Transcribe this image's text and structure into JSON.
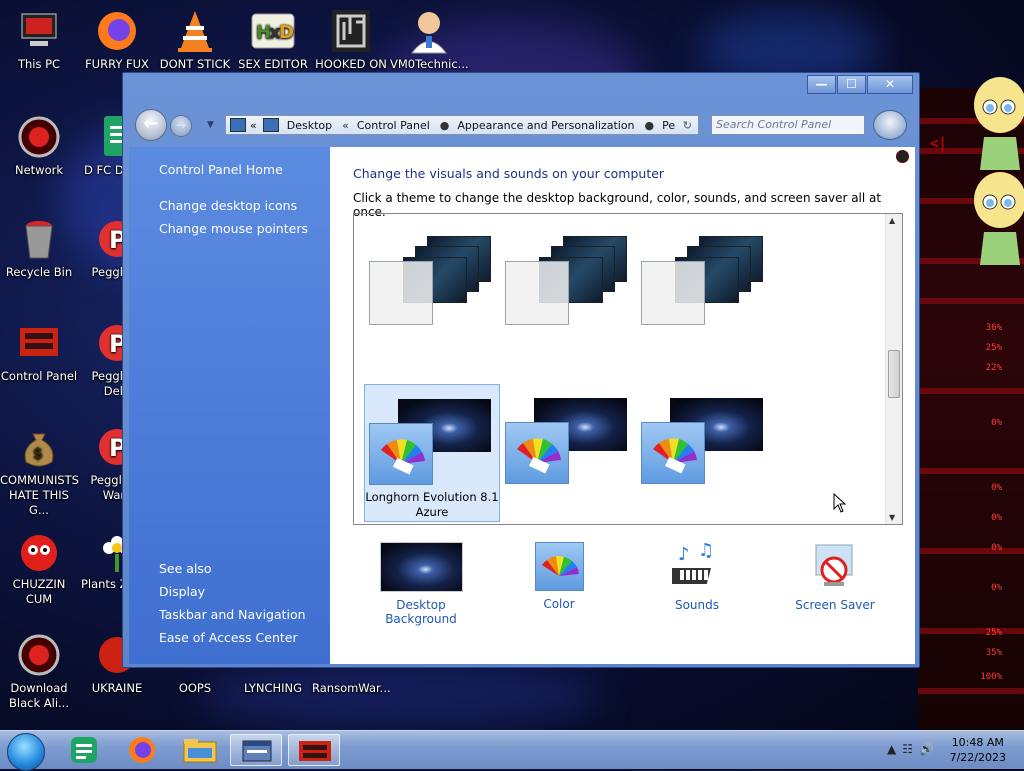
{
  "desktop": {
    "icons": [
      {
        "label": "This PC",
        "icon": "computer-icon"
      },
      {
        "label": "FURRY FUX",
        "icon": "firefox-icon"
      },
      {
        "label": "DONT STICK",
        "icon": "vlc-cone-icon"
      },
      {
        "label": "SEX EDITOR",
        "icon": "hex-editor-icon"
      },
      {
        "label": "HOOKED ON",
        "icon": "maze-icon"
      },
      {
        "label": "VM0Technic...",
        "icon": "doctor-icon"
      },
      {
        "label": "Network",
        "icon": "network-icon"
      },
      {
        "label": "D FC DUMB",
        "icon": "document-icon"
      },
      {
        "label": "Recycle Bin",
        "icon": "recycle-bin-icon"
      },
      {
        "label": "Peggle D",
        "icon": "peggle-icon"
      },
      {
        "label": "Control Panel",
        "icon": "control-panel-icon"
      },
      {
        "label": "Peggle D Delu",
        "icon": "peggle-icon"
      },
      {
        "label": "COMMUNISTS HATE THIS G...",
        "icon": "money-bag-icon"
      },
      {
        "label": "Peggle of Warc",
        "icon": "peggle-icon"
      },
      {
        "label": "CHUZZIN CUM",
        "icon": "chuzzle-icon"
      },
      {
        "label": "Plants Zomb",
        "icon": "flower-icon"
      },
      {
        "label": "Download Black Ali...",
        "icon": "download-icon"
      },
      {
        "label": "UKRAINE",
        "icon": "app-icon"
      },
      {
        "label": "OOPS",
        "icon": "app-icon"
      },
      {
        "label": "LYNCHING",
        "icon": "app-icon"
      },
      {
        "label": "RansomWar...",
        "icon": "app-icon"
      }
    ],
    "wallpaper_labels": [
      "36%",
      "25%",
      "22%",
      "0%",
      "0%",
      "0%",
      "0%",
      "0%",
      "25%",
      "35%",
      "100%"
    ]
  },
  "window": {
    "title_buttons": {
      "minimize": "—",
      "maximize": "☐",
      "close": "✕"
    },
    "address": {
      "prefix": "«",
      "crumbs": [
        "Desktop",
        "Control Panel",
        "Appearance and Personalization",
        "Pe"
      ]
    },
    "search_placeholder": "Search Control Panel"
  },
  "sidebar": {
    "top_links": [
      "Control Panel Home",
      "Change desktop icons",
      "Change mouse pointers"
    ],
    "see_also_label": "See also",
    "see_also_links": [
      "Display",
      "Taskbar and Navigation",
      "Ease of Access Center"
    ]
  },
  "main": {
    "heading": "Change the visuals and sounds on your computer",
    "subheading": "Click a theme to change the desktop background, color, sounds, and screen saver all at once.",
    "themes_row1": [
      {
        "name": ""
      },
      {
        "name": ""
      },
      {
        "name": ""
      }
    ],
    "themes_row2": [
      {
        "name": "Longhorn Evolution 8.1 Azure",
        "selected": true
      },
      {
        "name": "",
        "selected": false
      },
      {
        "name": "",
        "selected": false
      }
    ],
    "bottom_links": [
      {
        "label": "Desktop Background",
        "icon": "desktop-background-icon"
      },
      {
        "label": "Color",
        "icon": "color-icon"
      },
      {
        "label": "Sounds",
        "icon": "sounds-icon"
      },
      {
        "label": "Screen Saver",
        "icon": "screen-saver-icon"
      }
    ]
  },
  "taskbar": {
    "time": "10:48 AM",
    "date": "7/22/2023",
    "apps": [
      "start-orb-icon",
      "notes-icon",
      "firefox-icon",
      "file-explorer-icon",
      "control-panel-window-icon",
      "game-icon"
    ]
  },
  "colors": {
    "accent": "#3f6fd0",
    "link": "#1e5ab3",
    "heading": "#1e3287"
  }
}
